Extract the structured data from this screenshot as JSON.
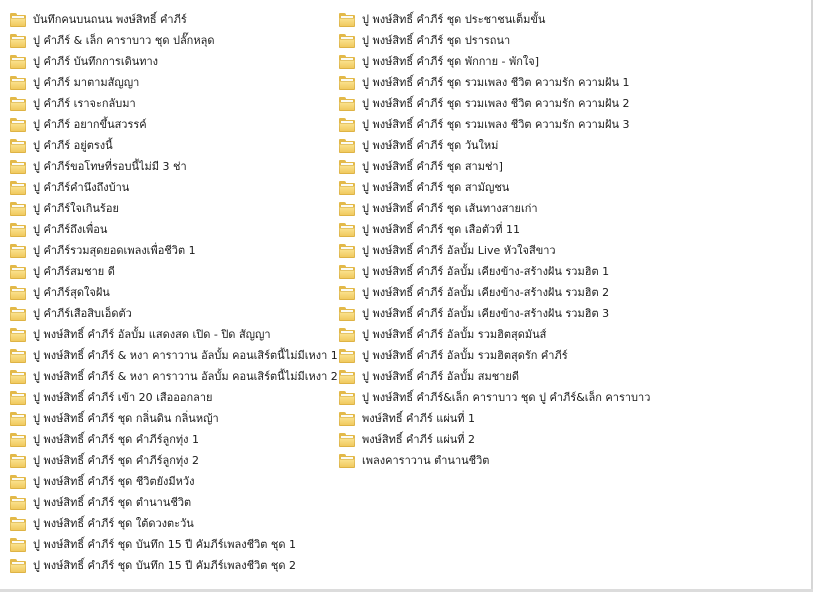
{
  "colors": {
    "folder": "#e3b949",
    "text": "#1a1a1a",
    "background": "#ffffff"
  },
  "icon": "folder-icon",
  "folders_left": [
    "บันทึกคนบนถนน พงษ์สิทธิ์ คำภีร์",
    "ปู คำภีร์ & เล็ก คาราบาว ชุด ปลั๊กหลุด",
    "ปู คำภีร์ บันทึกการเดินทาง",
    "ปู คำภีร์ มาตามสัญญา",
    "ปู คำภีร์ เราจะกลับมา",
    "ปู คำภีร์ อยากขึ้นสวรรค์",
    "ปู คำภีร์ อยู่ตรงนี้",
    "ปู คำภีร์ขอโทษที่รอบนี้ไม่มี 3 ช่า",
    "ปู คำภีร์คำนึงถึงบ้าน",
    "ปู คำภีร์ใจเกินร้อย",
    "ปู คำภีร์ถึงเพื่อน",
    "ปู คำภีร์รวมสุดยอดเพลงเพื่อชีวิต 1",
    "ปู คำภีร์สมชาย ดี",
    "ปู คำภีร์สุดใจฝัน",
    "ปู คำภีร์เสือสิบเอ็ดตัว",
    "ปู พงษ์สิทธิ์ คำภีร์  อัลบั้ม แสดงสด  เปิด - ปิด สัญญา",
    "ปู พงษ์สิทธิ์ คำภีร์ & หงา คาราวาน อัลบั้ม คอนเสิร์ตนี้ไม่มีเหงา 1",
    "ปู พงษ์สิทธิ์ คำภีร์ & หงา คาราวาน อัลบั้ม คอนเสิร์ตนี้ไม่มีเหงา 2",
    "ปู พงษ์สิทธิ์ คำภีร์ เข้า 20 เสือออกลาย",
    "ปู พงษ์สิทธิ์ คำภีร์ ชุด กลิ่นดิน กลิ่นหญ้า",
    "ปู พงษ์สิทธิ์ คำภีร์ ชุด คำภีร์ลูกทุ่ง 1",
    "ปู พงษ์สิทธิ์ คำภีร์ ชุด คำภีร์ลูกทุ่ง 2",
    "ปู พงษ์สิทธิ์ คำภีร์ ชุด ชีวิตยังมีหวัง",
    "ปู พงษ์สิทธิ์ คำภีร์ ชุด ตำนานชีวิต",
    "ปู พงษ์สิทธิ์ คำภีร์ ชุด ใต้ดวงตะวัน",
    "ปู พงษ์สิทธิ์ คำภีร์ ชุด บันทึก 15 ปี คัมภีร์เพลงชีวิต ชุด 1",
    "ปู พงษ์สิทธิ์ คำภีร์ ชุด บันทึก 15 ปี คัมภีร์เพลงชีวิต ชุด 2"
  ],
  "folders_right": [
    "ปู พงษ์สิทธิ์ คำภีร์ ชุด ประชาชนเต็มขั้น",
    "ปู พงษ์สิทธิ์ คำภีร์ ชุด ปรารถนา",
    "ปู พงษ์สิทธิ์ คำภีร์ ชุด พักกาย - พักใจ]",
    "ปู พงษ์สิทธิ์ คำภีร์ ชุด รวมเพลง ชีวิต ความรัก ความฝัน 1",
    "ปู พงษ์สิทธิ์ คำภีร์ ชุด รวมเพลง ชีวิต ความรัก ความฝัน 2",
    "ปู พงษ์สิทธิ์ คำภีร์ ชุด รวมเพลง ชีวิต ความรัก ความฝัน 3",
    "ปู พงษ์สิทธิ์ คำภีร์ ชุด วันใหม่",
    "ปู พงษ์สิทธิ์ คำภีร์ ชุด สามช่า]",
    "ปู พงษ์สิทธิ์ คำภีร์ ชุด สามัญชน",
    "ปู พงษ์สิทธิ์ คำภีร์ ชุด เส้นทางสายเก่า",
    "ปู พงษ์สิทธิ์ คำภีร์ ชุด เสือตัวที่ 11",
    "ปู พงษ์สิทธิ์ คำภีร์ อัลบั้ม Live หัวใจสีขาว",
    "ปู พงษ์สิทธิ์ คำภีร์ อัลบั้ม เคียงข้าง-สร้างฝัน รวมฮิต 1",
    "ปู พงษ์สิทธิ์ คำภีร์ อัลบั้ม เคียงข้าง-สร้างฝัน รวมฮิต 2",
    "ปู พงษ์สิทธิ์ คำภีร์ อัลบั้ม เคียงข้าง-สร้างฝัน รวมฮิต 3",
    "ปู พงษ์สิทธิ์ คำภีร์ อัลบั้ม รวมฮิตสุดมันส์",
    "ปู พงษ์สิทธิ์ คำภีร์ อัลบั้ม รวมฮิตสุดรัก คำภีร์",
    "ปู พงษ์สิทธิ์ คำภีร์ อัลบั้ม สมชายดี",
    "ปู พงษ์สิทธิ์ คำภีร์&เล็ก คาราบาว ชุด ปู คำภีร์&เล็ก คาราบาว",
    "พงษ์สิทธิ์ คำภีร์ แผ่นที่ 1",
    "พงษ์สิทธิ์ คำภีร์ แผ่นที่ 2",
    "เพลงคาราวาน ตำนานชีวิต"
  ]
}
